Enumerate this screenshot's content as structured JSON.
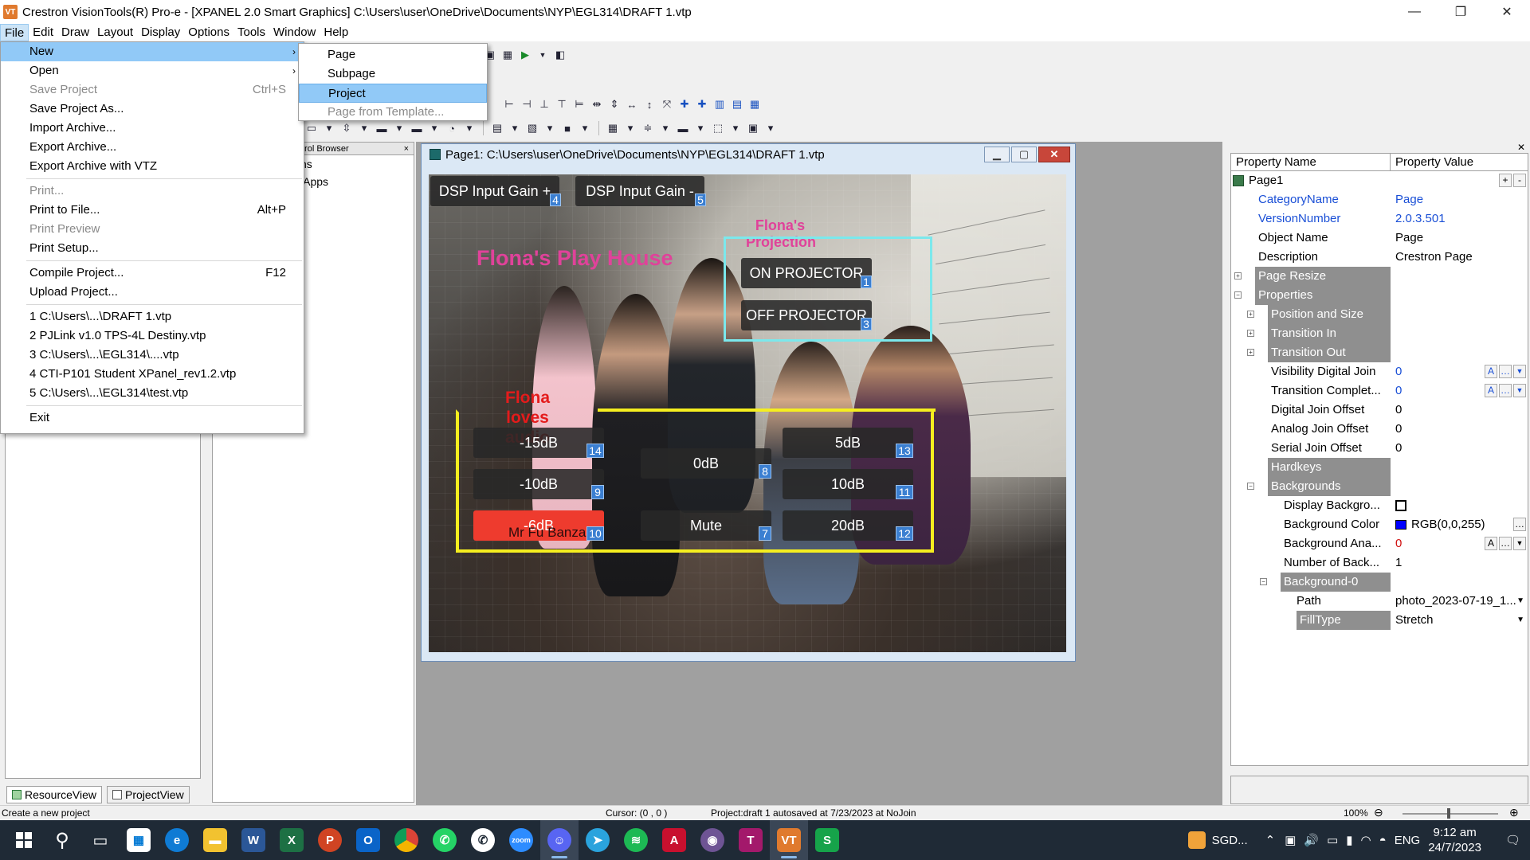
{
  "window": {
    "title": "Crestron VisionTools(R) Pro-e - [XPANEL 2.0 Smart Graphics] C:\\Users\\user\\OneDrive\\Documents\\NYP\\EGL314\\DRAFT 1.vtp",
    "minimize": "—",
    "maximize": "❐",
    "close": "✕"
  },
  "menubar": [
    "File",
    "Edit",
    "Draw",
    "Layout",
    "Display",
    "Options",
    "Tools",
    "Window",
    "Help"
  ],
  "file_menu": {
    "new": "New",
    "open": "Open",
    "save_project": "Save Project",
    "save_project_shortcut": "Ctrl+S",
    "save_project_as": "Save Project As...",
    "import_archive": "Import Archive...",
    "export_archive": "Export Archive...",
    "export_archive_vtz": "Export Archive with VTZ",
    "print": "Print...",
    "print_to_file": "Print to File...",
    "print_to_file_shortcut": "Alt+P",
    "print_preview": "Print Preview",
    "print_setup": "Print Setup...",
    "compile_project": "Compile Project...",
    "compile_shortcut": "F12",
    "upload_project": "Upload Project...",
    "recent": [
      "1 C:\\Users\\...\\DRAFT 1.vtp",
      "2 PJLink v1.0 TPS-4L Destiny.vtp",
      "3 C:\\Users\\...\\EGL314\\....vtp",
      "4 CTI-P101 Student XPanel_rev1.2.vtp",
      "5 C:\\Users\\...\\EGL314\\test.vtp"
    ],
    "exit": "Exit"
  },
  "new_submenu": {
    "page": "Page",
    "subpage": "Subpage",
    "project": "Project",
    "page_from_template": "Page from Template..."
  },
  "control_browser": {
    "title": "trol Browser",
    "close": "×",
    "items": [
      "ns",
      "lApps"
    ]
  },
  "left_panel": {
    "tab_resource": "ResourceView",
    "tab_project": "ProjectView"
  },
  "page_window": {
    "title": "Page1: C:\\Users\\user\\OneDrive\\Documents\\NYP\\EGL314\\DRAFT 1.vtp"
  },
  "canvas": {
    "title_label": "Flona's Play House",
    "projection_label": "Flona's Projection",
    "audio_label": "Flona loves audio",
    "mr_label": "Mr Fu Banzai",
    "buttons": [
      {
        "label": "DSP Input Gain +",
        "join": "4"
      },
      {
        "label": "DSP Input Gain -",
        "join": "5"
      },
      {
        "label": "ON PROJECTOR",
        "join": "1"
      },
      {
        "label": "OFF PROJECTOR",
        "join": "3"
      },
      {
        "label": "-15dB",
        "join": "14"
      },
      {
        "label": "0dB",
        "join": "8"
      },
      {
        "label": "5dB",
        "join": "13"
      },
      {
        "label": "-10dB",
        "join": "9"
      },
      {
        "label": "10dB",
        "join": "11"
      },
      {
        "label": "-6dB",
        "join": "10"
      },
      {
        "label": "Mute",
        "join": "7"
      },
      {
        "label": "20dB",
        "join": "12"
      }
    ]
  },
  "properties": {
    "header_name": "Property Name",
    "header_value": "Property Value",
    "root": "Page1",
    "rows": [
      {
        "name": "CategoryName",
        "value": "Page"
      },
      {
        "name": "VersionNumber",
        "value": "2.0.3.501"
      },
      {
        "name": "Object Name",
        "value": "Page"
      },
      {
        "name": "Description",
        "value": "Crestron Page"
      },
      {
        "name": "Page Resize",
        "value": ""
      },
      {
        "name": "Properties",
        "value": ""
      },
      {
        "name": "Position and Size",
        "value": ""
      },
      {
        "name": "Transition In",
        "value": ""
      },
      {
        "name": "Transition Out",
        "value": ""
      },
      {
        "name": "Visibility Digital Join",
        "value": "0"
      },
      {
        "name": "Transition Complet...",
        "value": "0"
      },
      {
        "name": "Digital Join Offset",
        "value": "0"
      },
      {
        "name": "Analog Join Offset",
        "value": "0"
      },
      {
        "name": "Serial Join Offset",
        "value": "0"
      },
      {
        "name": "Hardkeys",
        "value": ""
      },
      {
        "name": "Backgrounds",
        "value": ""
      },
      {
        "name": "Display Backgro...",
        "value": ""
      },
      {
        "name": "Background Color",
        "value": "RGB(0,0,255)"
      },
      {
        "name": "Background Ana...",
        "value": "0"
      },
      {
        "name": "Number of Back...",
        "value": "1"
      },
      {
        "name": "Background-0",
        "value": ""
      },
      {
        "name": "Path",
        "value": "photo_2023-07-19_1..."
      },
      {
        "name": "FillType",
        "value": "Stretch"
      }
    ],
    "background_color_hex": "#0000ff"
  },
  "statusbar": {
    "hint": "Create a new project",
    "cursor": "Cursor: (0 , 0 )",
    "autosave": "Project:draft 1 autosaved at 7/23/2023 at  NoJoin",
    "zoom": "100%"
  },
  "taskbar": {
    "tray_text": "SGD...",
    "language": "ENG",
    "time": "9:12 am",
    "date": "24/7/2023"
  },
  "colors": {
    "menu_highlight": "#91c9f7",
    "canvas_label_pink": "#e0429a",
    "canvas_label_red": "#e41b1b",
    "join_tag": "#3b7fd1",
    "box_cyan": "#7be8ec",
    "box_yellow": "#f5ee1f",
    "red_button": "#ee3b2e"
  }
}
